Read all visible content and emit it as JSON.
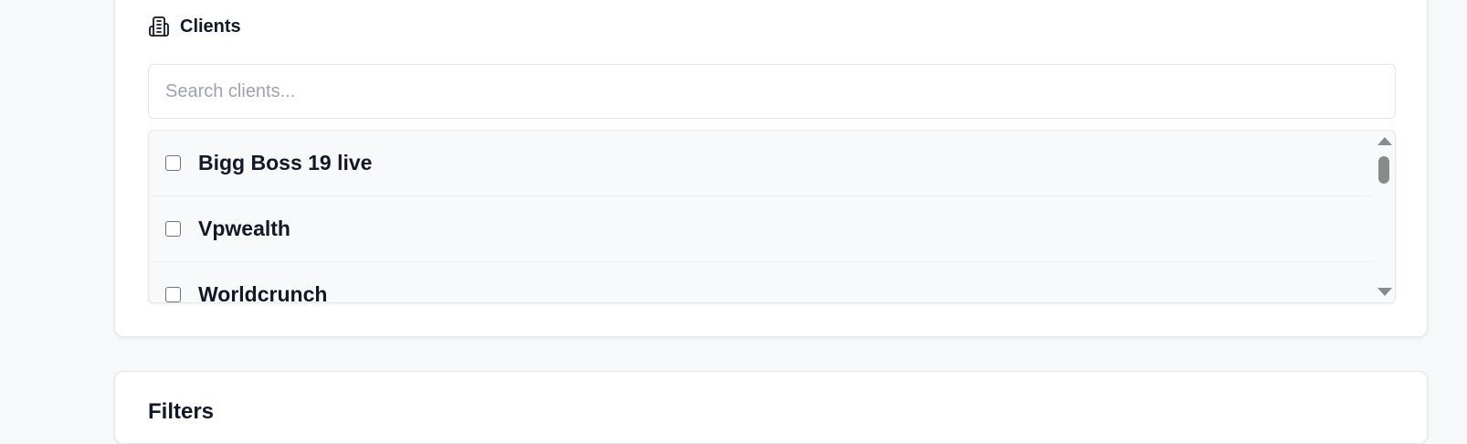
{
  "clients_section": {
    "title": "Clients",
    "icon": "building-icon",
    "search": {
      "placeholder": "Search clients...",
      "value": ""
    },
    "items": [
      {
        "label": "Bigg Boss 19 live",
        "checked": false
      },
      {
        "label": "Vpwealth",
        "checked": false
      },
      {
        "label": "Worldcrunch",
        "checked": false
      }
    ]
  },
  "filters_section": {
    "title": "Filters"
  },
  "colors": {
    "page_background": "#f7f8fa",
    "card_background": "#ffffff",
    "list_background": "#f8f9fb",
    "text_primary": "#111827",
    "placeholder": "#9ca3af",
    "scrollbar": "#8a8a8a"
  }
}
